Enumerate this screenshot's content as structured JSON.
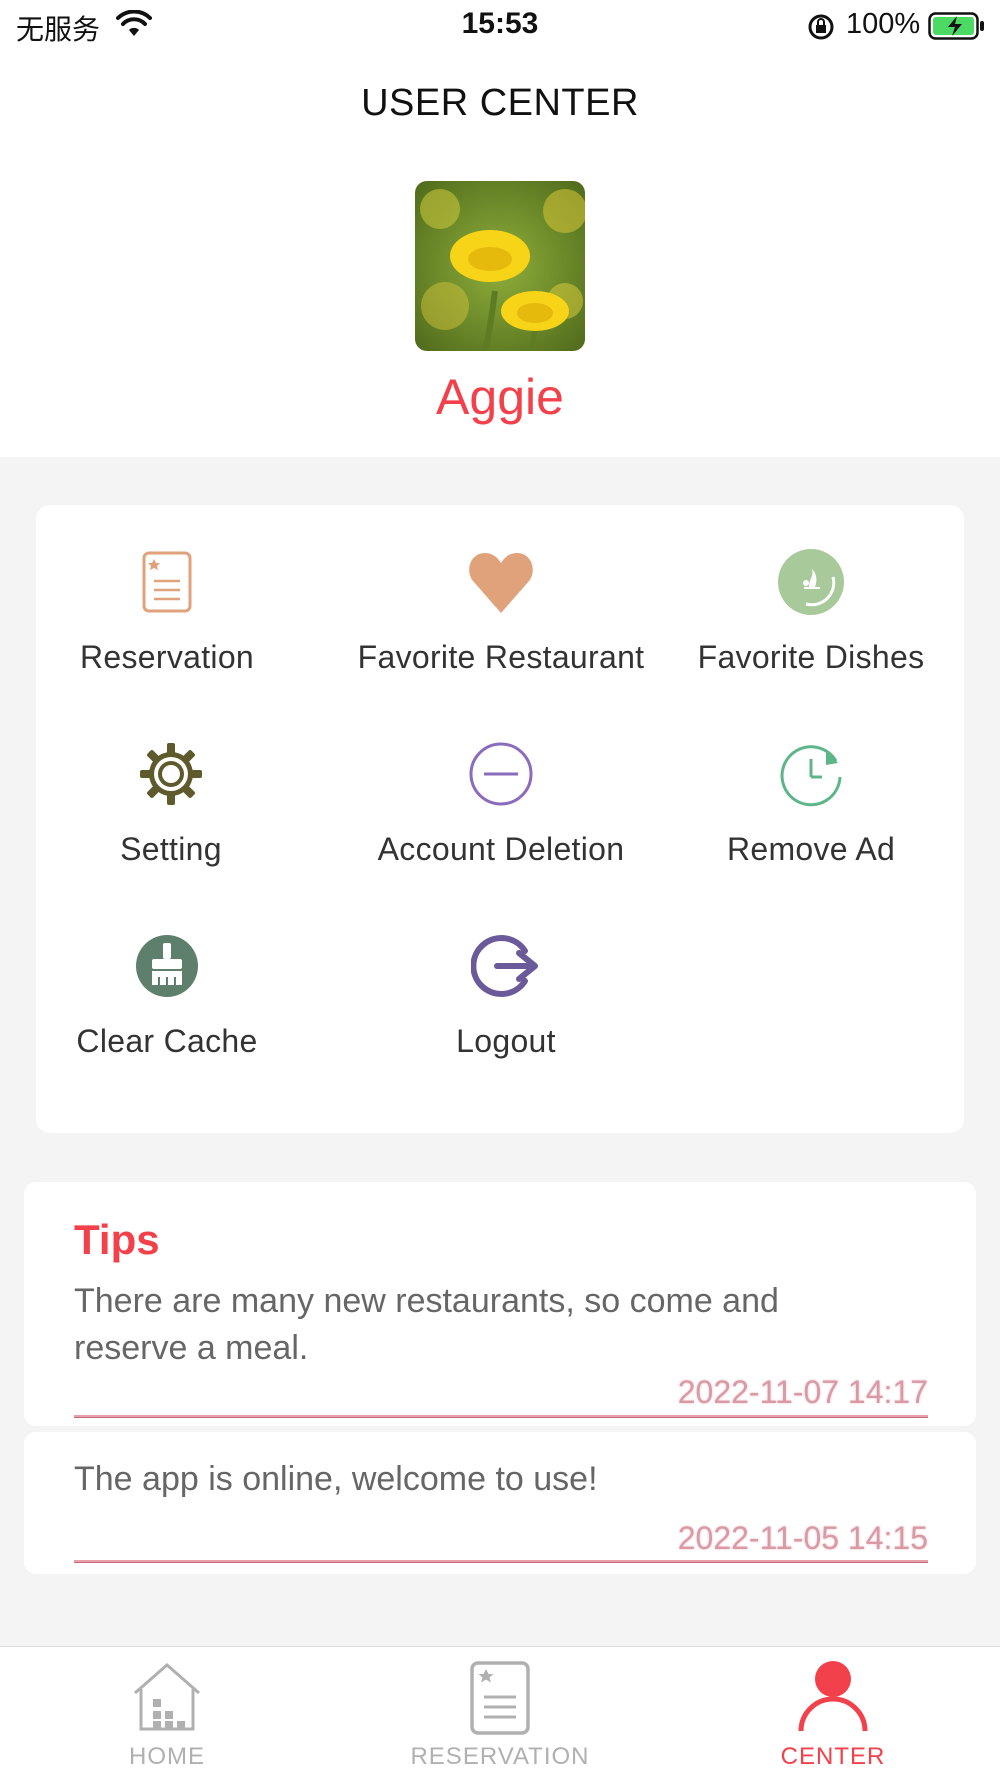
{
  "status_bar": {
    "carrier": "无服务",
    "time": "15:53",
    "battery": "100%"
  },
  "header": {
    "title": "USER CENTER",
    "username": "Aggie"
  },
  "menu": {
    "items": [
      {
        "label": "Reservation",
        "icon": "reservation-list-icon"
      },
      {
        "label": "Favorite Restaurant",
        "icon": "heart-icon"
      },
      {
        "label": "Favorite Dishes",
        "icon": "dish-icon"
      },
      {
        "label": "Setting",
        "icon": "gear-icon"
      },
      {
        "label": "Account Deletion",
        "icon": "minus-circle-icon"
      },
      {
        "label": "Remove Ad",
        "icon": "clock-refresh-icon"
      },
      {
        "label": "Clear Cache",
        "icon": "broom-icon"
      },
      {
        "label": "Logout",
        "icon": "logout-icon"
      }
    ]
  },
  "tips": {
    "title": "Tips",
    "items": [
      {
        "text": "There are many new restaurants, so come and reserve a meal.",
        "date": "2022-11-07 14:17"
      },
      {
        "text": "The app is online, welcome to use!",
        "date": "2022-11-05 14:15"
      }
    ]
  },
  "tab_bar": {
    "tabs": [
      {
        "label": "HOME",
        "icon": "home-icon",
        "active": false
      },
      {
        "label": "RESERVATION",
        "icon": "reservation-icon",
        "active": false
      },
      {
        "label": "CENTER",
        "icon": "user-icon",
        "active": true
      }
    ]
  },
  "colors": {
    "accent": "#f2414a",
    "heart": "#e0a27a",
    "dish": "#a8c99a",
    "gear": "#5f5a2c",
    "account_deletion": "#8a6bbd",
    "remove_ad": "#5fb58a",
    "clear_cache": "#5e7f6c",
    "logout": "#6a5a9a"
  }
}
